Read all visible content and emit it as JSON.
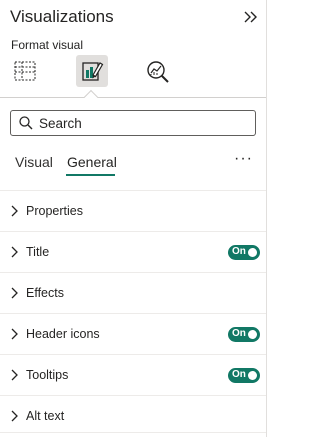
{
  "pane": {
    "title": "Visualizations",
    "collapse_icon": "double-chevron-right-icon"
  },
  "format": {
    "subtitle": "Format visual",
    "icons": [
      {
        "name": "build-visual-icon",
        "active": false
      },
      {
        "name": "format-visual-icon",
        "active": true
      },
      {
        "name": "analytics-icon",
        "active": false
      }
    ]
  },
  "search": {
    "placeholder": "Search",
    "value": ""
  },
  "tabs": {
    "visual": "Visual",
    "general": "General",
    "selected": "General",
    "more": "···"
  },
  "sections": [
    {
      "label": "Properties",
      "toggle": null
    },
    {
      "label": "Title",
      "toggle": "On"
    },
    {
      "label": "Effects",
      "toggle": null
    },
    {
      "label": "Header icons",
      "toggle": "On"
    },
    {
      "label": "Tooltips",
      "toggle": "On"
    },
    {
      "label": "Alt text",
      "toggle": null
    }
  ],
  "colors": {
    "accent": "#117865",
    "selected_bg": "#e1dfdd"
  }
}
